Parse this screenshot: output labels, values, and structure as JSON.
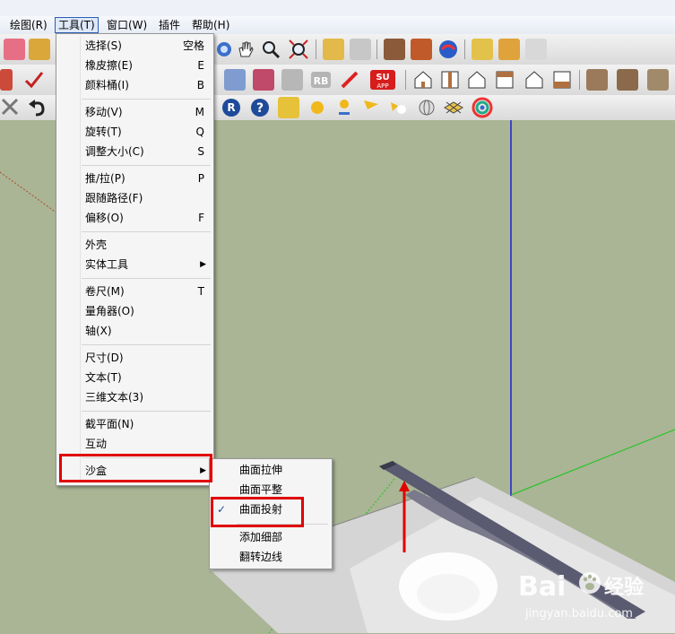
{
  "menubar": {
    "items": [
      {
        "label": "绘图(R)"
      },
      {
        "label": "工具(T)"
      },
      {
        "label": "窗口(W)"
      },
      {
        "label": "插件"
      },
      {
        "label": "帮助(H)"
      }
    ]
  },
  "tools_menu": {
    "items": [
      {
        "label": "选择(S)",
        "shortcut": "空格"
      },
      {
        "label": "橡皮擦(E)",
        "shortcut": "E"
      },
      {
        "label": "颜料桶(I)",
        "shortcut": "B"
      },
      {
        "label": "移动(V)",
        "shortcut": "M"
      },
      {
        "label": "旋转(T)",
        "shortcut": "Q"
      },
      {
        "label": "调整大小(C)",
        "shortcut": "S"
      },
      {
        "label": "推/拉(P)",
        "shortcut": "P"
      },
      {
        "label": "跟随路径(F)",
        "shortcut": ""
      },
      {
        "label": "偏移(O)",
        "shortcut": "F"
      },
      {
        "label": "外壳",
        "shortcut": ""
      },
      {
        "label": "实体工具",
        "shortcut": ""
      },
      {
        "label": "卷尺(M)",
        "shortcut": "T"
      },
      {
        "label": "量角器(O)",
        "shortcut": ""
      },
      {
        "label": "轴(X)",
        "shortcut": ""
      },
      {
        "label": "尺寸(D)",
        "shortcut": ""
      },
      {
        "label": "文本(T)",
        "shortcut": ""
      },
      {
        "label": "三维文本(3)",
        "shortcut": ""
      },
      {
        "label": "截平面(N)",
        "shortcut": ""
      },
      {
        "label": "互动",
        "shortcut": ""
      },
      {
        "label": "沙盒",
        "shortcut": ""
      }
    ]
  },
  "sandbox_submenu": {
    "check_mark": "✓",
    "items": [
      {
        "label": "曲面拉伸"
      },
      {
        "label": "曲面平整"
      },
      {
        "label": "曲面投射",
        "checked": true
      },
      {
        "label": "添加细部"
      },
      {
        "label": "翻转边线"
      }
    ]
  },
  "toolbar_text": {
    "su_app": "SU",
    "su_app_sub": "APP",
    "rb": "RB",
    "r_badge": "R",
    "help_badge": "?"
  },
  "watermark": {
    "brand": "Bai",
    "brand_tail": "经验",
    "url": "jingyan.baidu.com"
  },
  "colors": {
    "viewport_bg": "#a9b595",
    "highlight_red": "#e00000",
    "axis_blue": "#1b22d6",
    "axis_green": "#1ac41a",
    "axis_red": "#b04a2a"
  }
}
